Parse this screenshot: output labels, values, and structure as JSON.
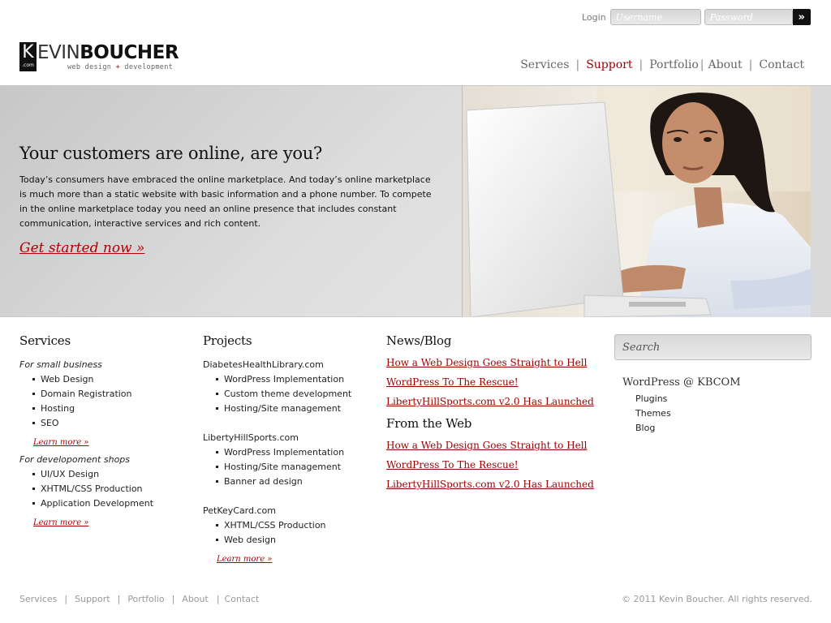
{
  "login": {
    "label": "Login",
    "username_placeholder": "Username",
    "password_placeholder": "Password",
    "go_glyph": "»"
  },
  "logo": {
    "k": "K",
    "com": ".com",
    "evin": "EVIN",
    "boucher": "BOUCHER",
    "tag_left": "web design ",
    "tag_plus": "+",
    "tag_right": " development"
  },
  "nav": {
    "items": [
      {
        "label": "Services",
        "active": false
      },
      {
        "label": "Support",
        "active": true
      },
      {
        "label": "Portfolio",
        "active": false
      },
      {
        "label": "About",
        "active": false
      },
      {
        "label": "Contact",
        "active": false
      }
    ],
    "separator": "|"
  },
  "hero": {
    "title": "Your customers are online, are you?",
    "body": "Today’s consumers have embraced the online marketplace. And today’s online marketplace is much more than a static website with basic information and a phone number. To compete in the online marketplace today you need an online presence that includes constant communication, interactive services and rich content.",
    "cta": "Get started now »"
  },
  "services": {
    "heading": "Services",
    "groups": [
      {
        "label": "For small business",
        "items": [
          "Web Design",
          "Domain Registration",
          "Hosting",
          "SEO"
        ],
        "learn_more": "Learn more »"
      },
      {
        "label": "For developoment shops",
        "items": [
          "UI/UX Design",
          "XHTML/CSS Production",
          "Application Development"
        ],
        "learn_more": "Learn more »"
      }
    ]
  },
  "projects": {
    "heading": "Projects",
    "groups": [
      {
        "site": "DiabetesHealthLibrary.com",
        "items": [
          "WordPress Implementation",
          "Custom theme development",
          "Hosting/Site management"
        ]
      },
      {
        "site": "LibertyHillSports.com",
        "items": [
          "WordPress Implementation",
          "Hosting/Site management",
          "Banner ad design"
        ]
      },
      {
        "site": "PetKeyCard.com",
        "items": [
          "XHTML/CSS Production",
          "Web design"
        ]
      }
    ],
    "learn_more": "Learn more »"
  },
  "news": {
    "heading": "News/Blog",
    "links": [
      "How a Web Design Goes Straight to Hell",
      "WordPress To The Rescue!",
      "LibertyHillSports.com v2.0 Has Launched"
    ],
    "web_heading": "From the Web",
    "web_links": [
      "How a Web Design Goes Straight to Hell",
      "WordPress To The Rescue!",
      "LibertyHillSports.com v2.0 Has Launched"
    ]
  },
  "sidebar": {
    "search_placeholder": "Search",
    "wp_title": "WordPress @ KBCOM",
    "wp_items": [
      "Plugins",
      "Themes",
      "Blog"
    ]
  },
  "footer": {
    "links": [
      "Services",
      "Support",
      "Portfolio",
      "About",
      "Contact"
    ],
    "separator": "|",
    "copyright": "© 2011 Kevin Boucher. All rights reserved."
  },
  "colors": {
    "accent": "#9b0000",
    "text": "#222222",
    "muted": "#999999"
  }
}
